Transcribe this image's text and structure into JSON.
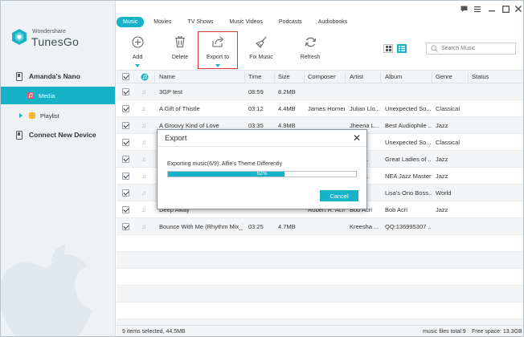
{
  "app": {
    "brand_small": "Wondershare",
    "brand_name": "TunesGo",
    "accent": "#17b2c7"
  },
  "sidebar": {
    "device": "Amanda's Nano",
    "items": [
      {
        "label": "Media",
        "active": true
      },
      {
        "label": "Playlist",
        "active": false
      }
    ],
    "connect": "Connect New Device"
  },
  "tabs": [
    {
      "label": "Music",
      "active": true
    },
    {
      "label": "Movies",
      "active": false
    },
    {
      "label": "TV Shows",
      "active": false
    },
    {
      "label": "Music Videos",
      "active": false
    },
    {
      "label": "Podcasts",
      "active": false
    },
    {
      "label": "Audiobooks",
      "active": false
    }
  ],
  "toolbar": {
    "add": "Add",
    "delete": "Delete",
    "export": "Export to",
    "fix": "Fix Music",
    "refresh": "Refresh"
  },
  "search": {
    "placeholder": "Search Music"
  },
  "table": {
    "columns": [
      "Name",
      "Time",
      "Size",
      "Composer",
      "Artist",
      "Album",
      "Genre",
      "Status"
    ],
    "rows": [
      {
        "name": "3GP test",
        "time": "08:59",
        "size": "8.2MB",
        "composer": "",
        "artist": "",
        "album": "",
        "genre": ""
      },
      {
        "name": "A Gift of Thistle",
        "time": "03:12",
        "size": "4.4MB",
        "composer": "James Horner",
        "artist": "Julian Llo...",
        "album": "Unexpected So...",
        "genre": "Classical"
      },
      {
        "name": "A Groovy Kind of Love",
        "time": "03:35",
        "size": "4.9MB",
        "composer": "",
        "artist": "Jheena L...",
        "album": "Best Audiophile ...",
        "genre": "Jazz"
      },
      {
        "name": "",
        "time": "",
        "size": "",
        "composer": "",
        "artist": "...",
        "album": "Unexpected So...",
        "genre": "Classical"
      },
      {
        "name": "",
        "time": "",
        "size": "",
        "composer": "",
        "artist": "...Wa...",
        "album": "Great Ladies of ...",
        "genre": "Jazz"
      },
      {
        "name": "",
        "time": "",
        "size": "",
        "composer": "",
        "artist": "...Wa...",
        "album": "NEA Jazz Masters",
        "genre": "Jazz"
      },
      {
        "name": "",
        "time": "",
        "size": "",
        "composer": "",
        "artist": "",
        "album": "Lisa's Ono Boss...",
        "genre": "World"
      },
      {
        "name": "Deep Away",
        "time": "",
        "size": "",
        "composer": "Robert R. Ach",
        "artist": "Bob Acri",
        "album": "Bob Acri",
        "genre": "Jazz"
      },
      {
        "name": "Bounce With Me (Rhythm Mix_) [",
        "time": "03:25",
        "size": "4.7MB",
        "composer": "",
        "artist": "Kreesha ...",
        "album": "QQ:136995307 ...",
        "genre": ""
      }
    ]
  },
  "status": {
    "selected": "9 items selected, 44.5MB",
    "total": "music files total:9",
    "free": "Free space: 13.3GB"
  },
  "dialog": {
    "title": "Export",
    "message": "Exporting music(6/9): Alfie's Theme Differently",
    "progress": 62,
    "progress_label": "62%",
    "cancel": "Cancel"
  }
}
